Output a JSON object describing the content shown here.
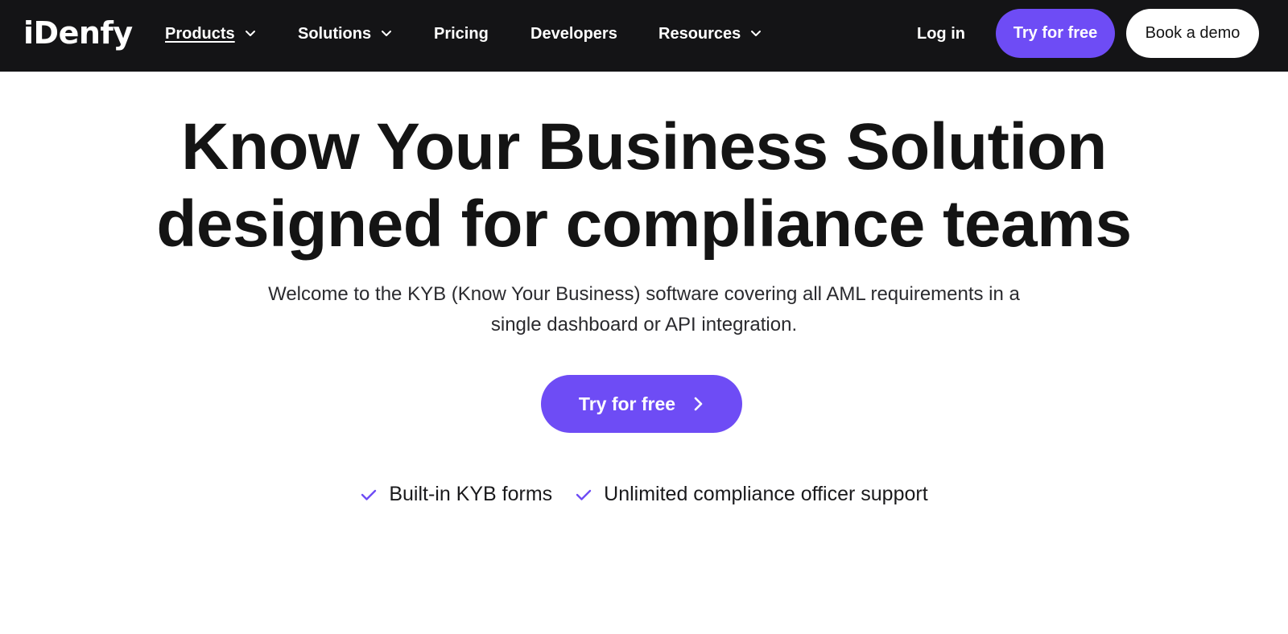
{
  "brand": {
    "logo_text": "iDenfy"
  },
  "nav": {
    "items": [
      {
        "label": "Products",
        "has_dropdown": true,
        "active": true
      },
      {
        "label": "Solutions",
        "has_dropdown": true,
        "active": false
      },
      {
        "label": "Pricing",
        "has_dropdown": false,
        "active": false
      },
      {
        "label": "Developers",
        "has_dropdown": false,
        "active": false
      },
      {
        "label": "Resources",
        "has_dropdown": true,
        "active": false
      }
    ],
    "login_label": "Log in",
    "try_label": "Try for free",
    "demo_label": "Book a demo"
  },
  "hero": {
    "title_line1": "Know Your Business Solution",
    "title_line2": "designed for compliance teams",
    "subtitle_line1": "Welcome to the KYB (Know Your Business) software covering all AML requirements in a",
    "subtitle_line2": "single dashboard or API integration.",
    "cta_label": "Try for free"
  },
  "features": [
    {
      "label": "Built-in KYB forms",
      "icon": "check-icon"
    },
    {
      "label": "Unlimited compliance officer support",
      "icon": "check-icon"
    }
  ],
  "colors": {
    "navbar_bg": "#141416",
    "accent": "#6e4cf5",
    "text": "#141414",
    "background": "#ffffff"
  }
}
